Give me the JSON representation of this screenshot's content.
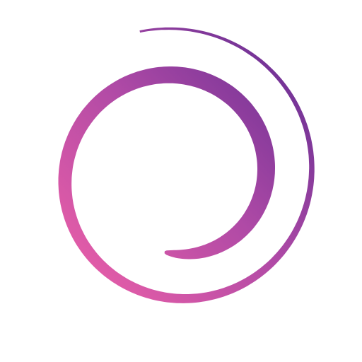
{
  "logo": {
    "icon": "spiral-swirl-icon",
    "colors": {
      "pink": "#f262a8",
      "magenta": "#b04aa6",
      "purple": "#5b2a90",
      "background": "#ffffff"
    }
  }
}
